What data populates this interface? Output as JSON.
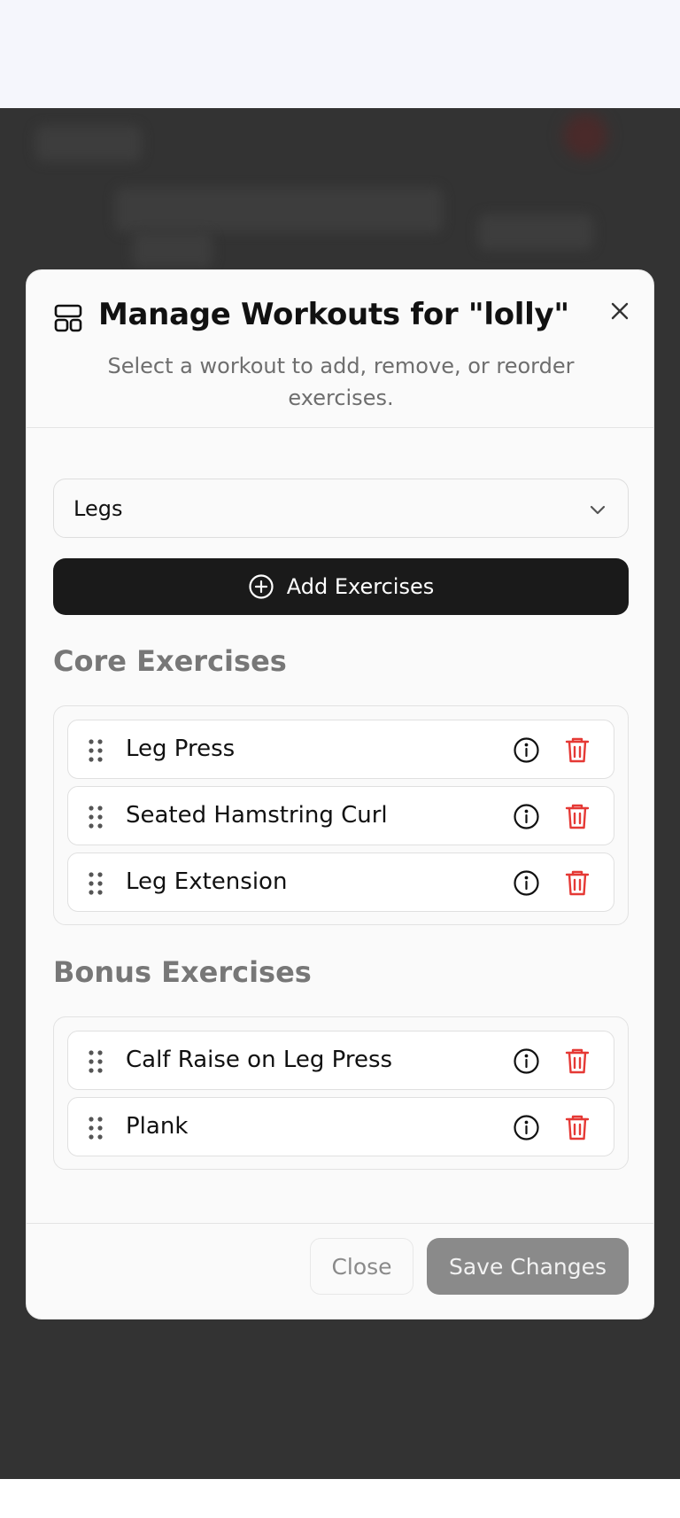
{
  "modal": {
    "title": "Manage Workouts for \"lolly\"",
    "subtitle": "Select a workout to add, remove, or reorder exercises.",
    "header_icon": "layout-icon",
    "close_icon": "close-icon"
  },
  "workout_select": {
    "value": "Legs",
    "icon": "chevron-down-icon"
  },
  "add_button": {
    "label": "Add Exercises",
    "icon": "plus-circle-icon"
  },
  "core_section": {
    "title": "Core Exercises",
    "items": [
      {
        "name": "Leg Press"
      },
      {
        "name": "Seated Hamstring Curl"
      },
      {
        "name": "Leg Extension"
      }
    ]
  },
  "bonus_section": {
    "title": "Bonus Exercises",
    "items": [
      {
        "name": "Calf Raise on Leg Press"
      },
      {
        "name": "Plank"
      }
    ]
  },
  "footer": {
    "close_label": "Close",
    "save_label": "Save Changes"
  },
  "colors": {
    "overlay": "#333333",
    "primary_button": "#1a1a1a",
    "delete_red": "#e53935",
    "save_disabled": "#8a8a8a"
  }
}
